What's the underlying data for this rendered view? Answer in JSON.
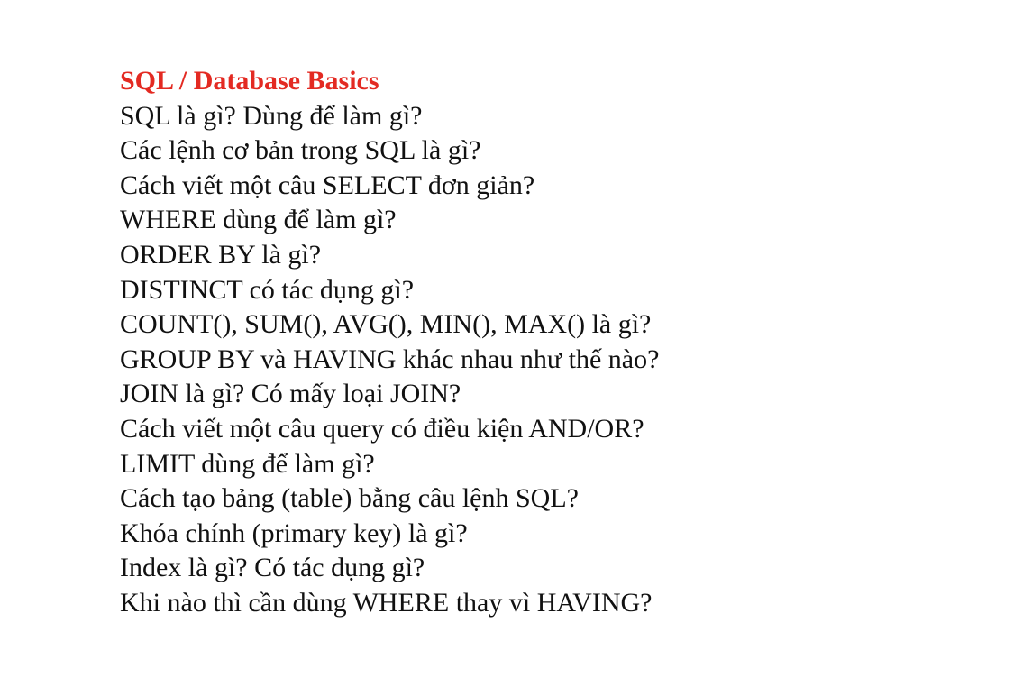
{
  "document": {
    "title": "SQL / Database Basics",
    "title_color": "#e32a22",
    "questions": [
      "SQL là gì? Dùng để làm gì?",
      "Các lệnh cơ bản trong SQL là gì?",
      "Cách viết một câu SELECT đơn giản?",
      "WHERE dùng để làm gì?",
      "ORDER BY là gì?",
      "DISTINCT có tác dụng gì?",
      "COUNT(), SUM(), AVG(), MIN(), MAX() là gì?",
      "GROUP BY và HAVING khác nhau như thế nào?",
      "JOIN là gì? Có mấy loại JOIN?",
      "Cách viết một câu query có điều kiện AND/OR?",
      "LIMIT dùng để làm gì?",
      "Cách tạo bảng (table) bằng câu lệnh SQL?",
      "Khóa chính (primary key) là gì?",
      "Index là gì? Có tác dụng gì?",
      "Khi nào thì cần dùng WHERE thay vì HAVING?"
    ]
  }
}
